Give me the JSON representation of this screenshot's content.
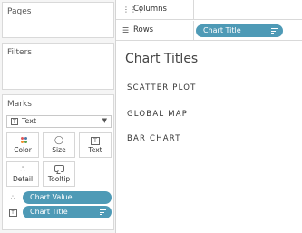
{
  "cards": {
    "pages_title": "Pages",
    "filters_title": "Filters",
    "marks_title": "Marks"
  },
  "marks": {
    "mark_type": "Text",
    "buttons": {
      "color": "Color",
      "size": "Size",
      "text": "Text",
      "detail": "Detail",
      "tooltip": "Tooltip"
    },
    "fields": [
      {
        "label": "Chart Value",
        "icon": "detail-dots-icon"
      },
      {
        "label": "Chart Title",
        "icon": "text-box-icon",
        "sorted": true
      }
    ]
  },
  "shelves": {
    "columns_label": "Columns",
    "rows_label": "Rows",
    "rows_pill": "Chart Title"
  },
  "view": {
    "title": "Chart Titles",
    "rows": [
      "SCATTER PLOT",
      "GLOBAL MAP",
      "BAR CHART"
    ]
  },
  "colors": {
    "pill": "#4e9ab6",
    "color_dots": [
      "#e15759",
      "#4e79a7",
      "#f28e2b",
      "#59a14f"
    ]
  }
}
